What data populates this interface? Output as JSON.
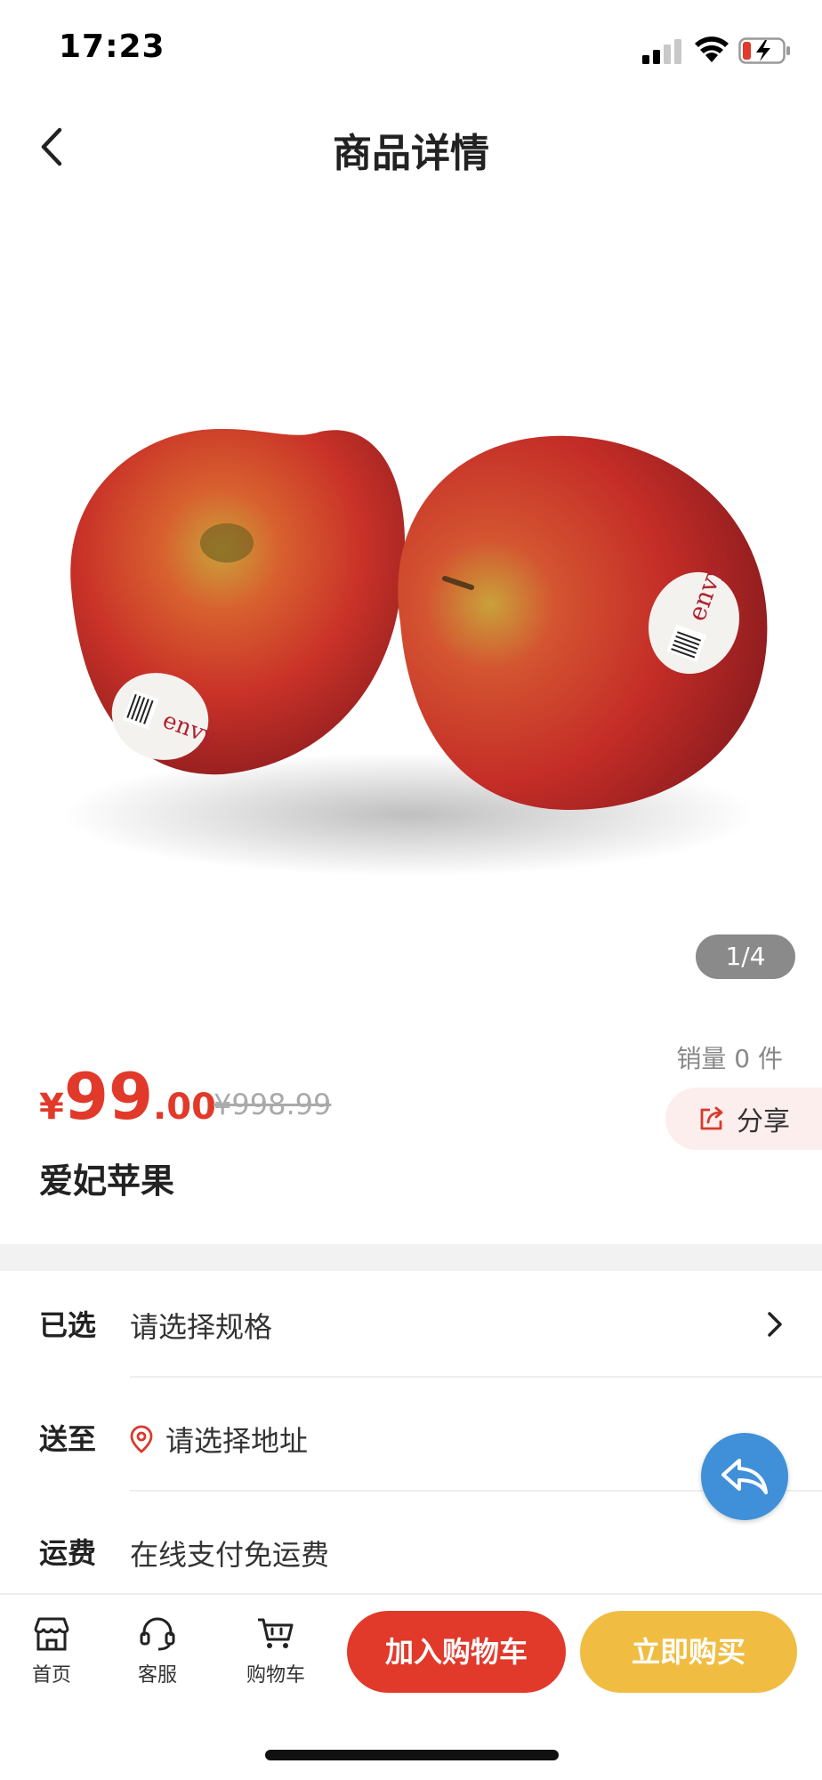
{
  "status_bar": {
    "time": "17:23"
  },
  "nav": {
    "title": "商品详情"
  },
  "gallery": {
    "indicator": "1/4",
    "current": 1,
    "total": 4,
    "sticker_text": "envy"
  },
  "product": {
    "sales_label": "销量 0 件",
    "price_symbol": "¥",
    "price_integer": "99",
    "price_decimal": ".00",
    "original_price": "¥998.99",
    "share_label": "分享",
    "name": "爱妃苹果"
  },
  "rows": {
    "selected_label": "已选",
    "selected_value": "请选择规格",
    "ship_to_label": "送至",
    "ship_to_value": "请选择地址",
    "shipping_label": "运费",
    "shipping_value": "在线支付免运费"
  },
  "bottom_bar": {
    "tabs": [
      {
        "label": "首页",
        "icon": "store-icon"
      },
      {
        "label": "客服",
        "icon": "headset-icon"
      },
      {
        "label": "购物车",
        "icon": "cart-icon"
      }
    ],
    "add_to_cart": "加入购物车",
    "buy_now": "立即购买"
  },
  "colors": {
    "accent_red": "#e1392a",
    "accent_yellow": "#f0bd42",
    "fab_blue": "#3f90d8"
  }
}
